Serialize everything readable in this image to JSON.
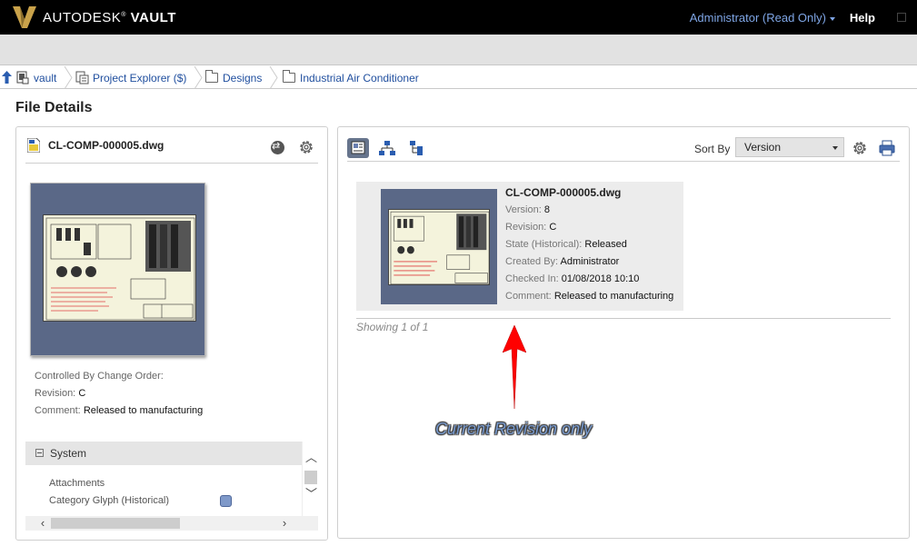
{
  "app": {
    "logo_brand": "AUTODESK",
    "logo_product": "VAULT",
    "user_menu": "Administrator (Read Only)",
    "help": "Help"
  },
  "breadcrumb": [
    {
      "label": "vault"
    },
    {
      "label": "Project Explorer ($)"
    },
    {
      "label": "Designs"
    },
    {
      "label": "Industrial Air Conditioner"
    }
  ],
  "page_title": "File Details",
  "left_panel": {
    "file_name": "CL-COMP-000005.dwg",
    "controlled_by_label": "Controlled By Change Order:",
    "revision_label": "Revision:",
    "revision_value": "C",
    "comment_label": "Comment:",
    "comment_value": "Released to manufacturing",
    "system": {
      "title": "System",
      "properties": [
        "Attachments",
        "Category Glyph (Historical)"
      ]
    }
  },
  "right_panel": {
    "sort_label": "Sort By",
    "sort_value": "Version",
    "card": {
      "title": "CL-COMP-000005.dwg",
      "rows": [
        {
          "label": "Version:",
          "value": "8"
        },
        {
          "label": "Revision:",
          "value": "C"
        },
        {
          "label": "State (Historical):",
          "value": "Released"
        },
        {
          "label": "Created By:",
          "value": "Administrator"
        },
        {
          "label": "Checked In:",
          "value": "01/08/2018 10:10"
        },
        {
          "label": "Comment:",
          "value": "Released to manufacturing"
        }
      ]
    },
    "showing": "Showing 1 of 1"
  },
  "annotation": {
    "text": "Current Revision only",
    "color": "#ff0000"
  },
  "colors": {
    "topbar": "#000000",
    "user_link": "#7fa6e6",
    "link": "#1f4e9e",
    "logo_gold": "#c9a24a"
  }
}
